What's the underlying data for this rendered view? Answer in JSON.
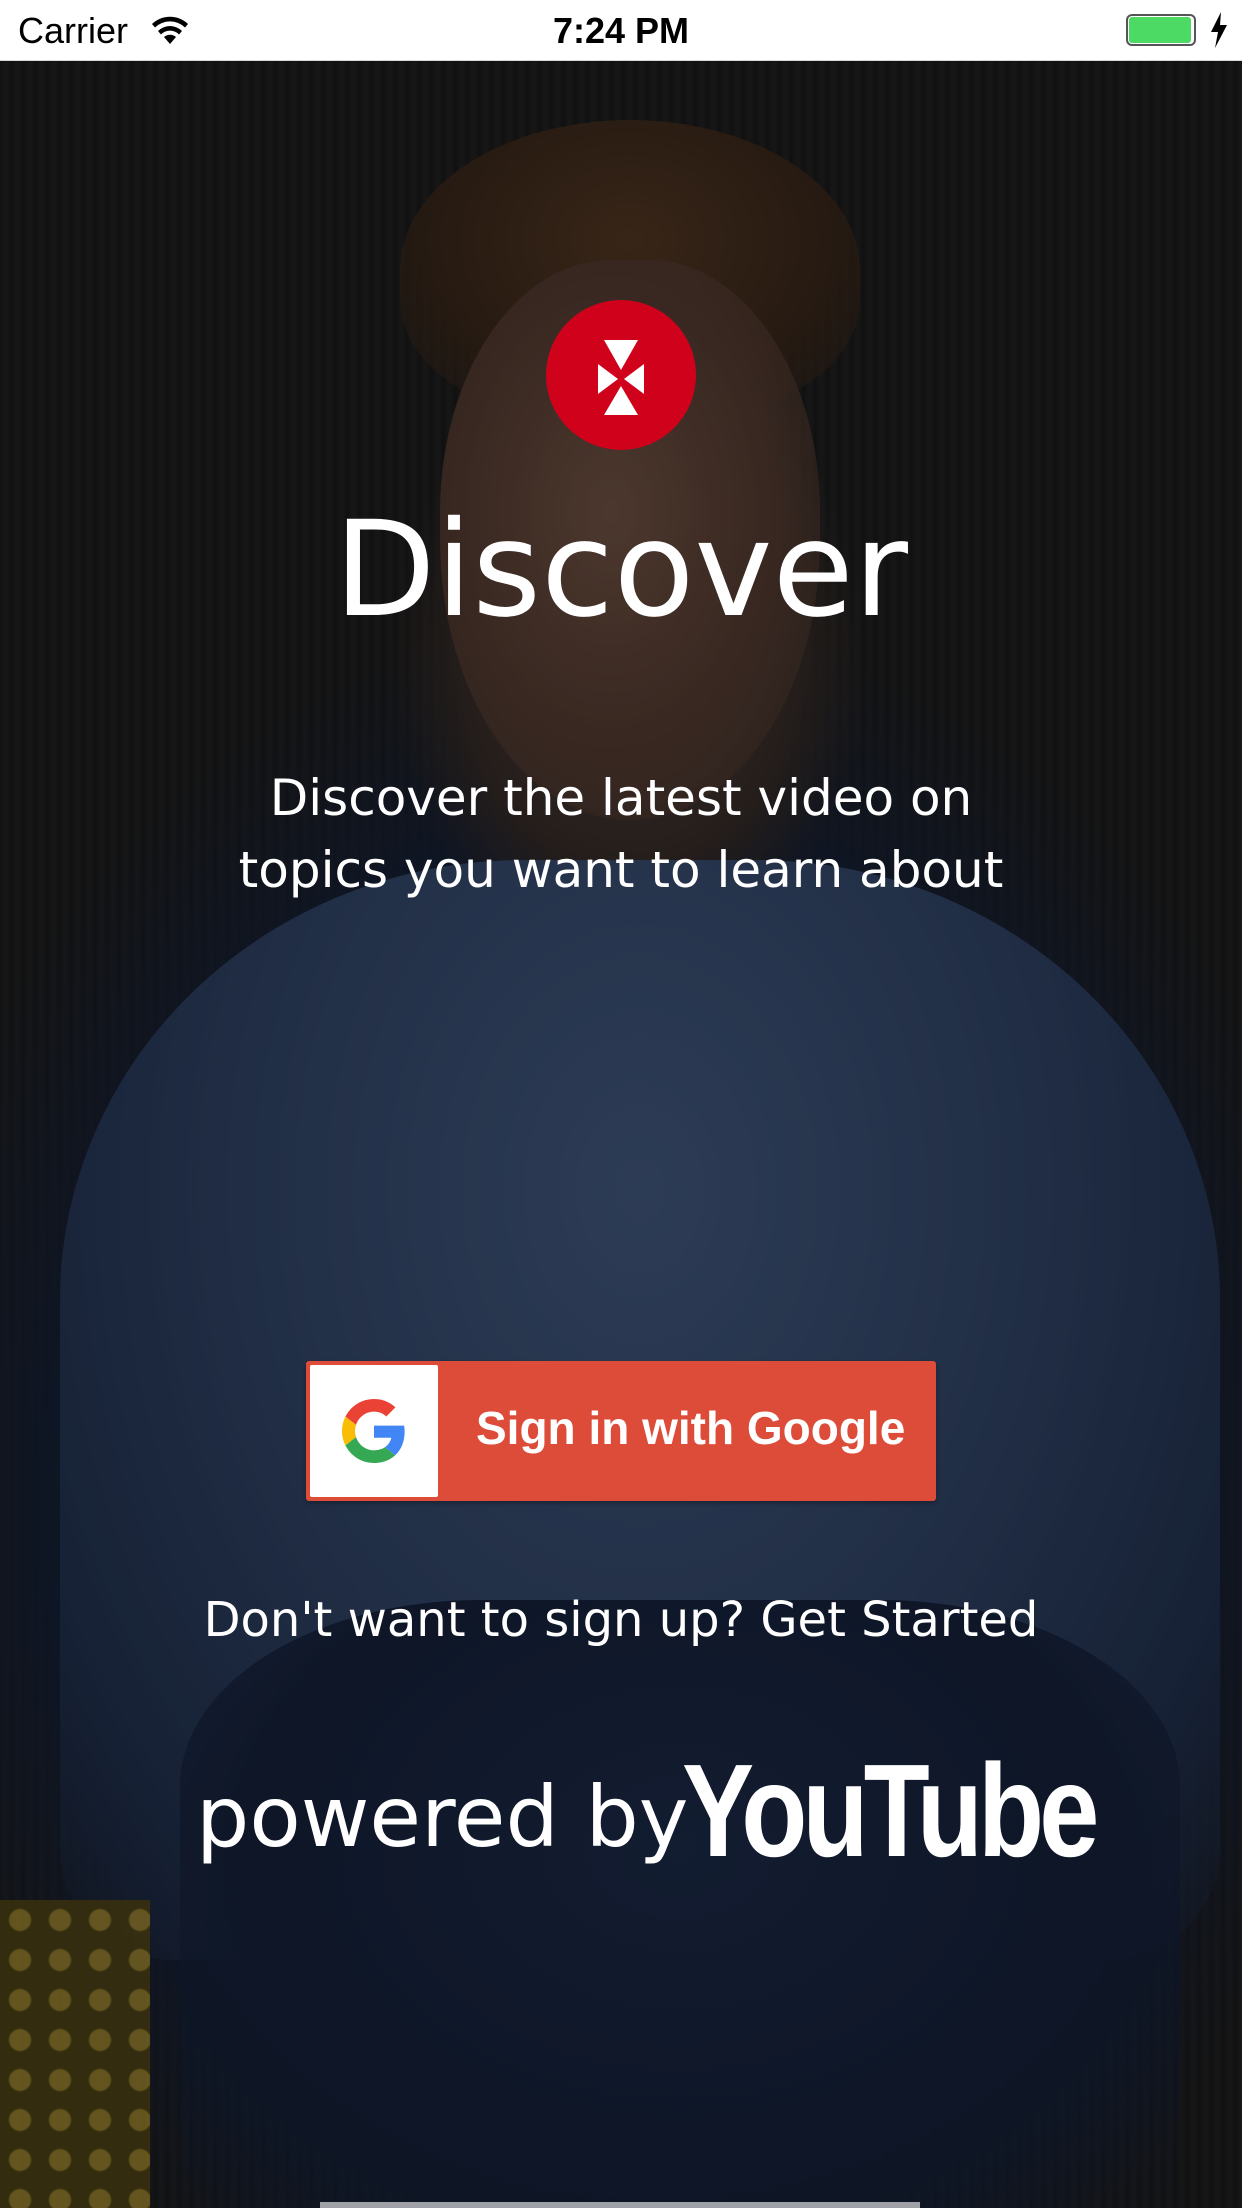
{
  "status_bar": {
    "carrier": "Carrier",
    "time": "7:24 PM",
    "battery_level": 1.0,
    "battery_color": "#4cd964"
  },
  "app": {
    "logo_icon": "red-circle-logo-icon",
    "logo_color": "#d0021b",
    "title": "Discover",
    "subtitle_line1": "Discover the latest video on",
    "subtitle_line2": "topics you want to learn about"
  },
  "google_button": {
    "label": "Sign in with Google",
    "icon": "google-g-icon",
    "color": "#dd4b39"
  },
  "get_started": {
    "text": "Don't want to sign up? Get Started"
  },
  "footer": {
    "powered_by": "powered by",
    "brand": "YouTube"
  }
}
